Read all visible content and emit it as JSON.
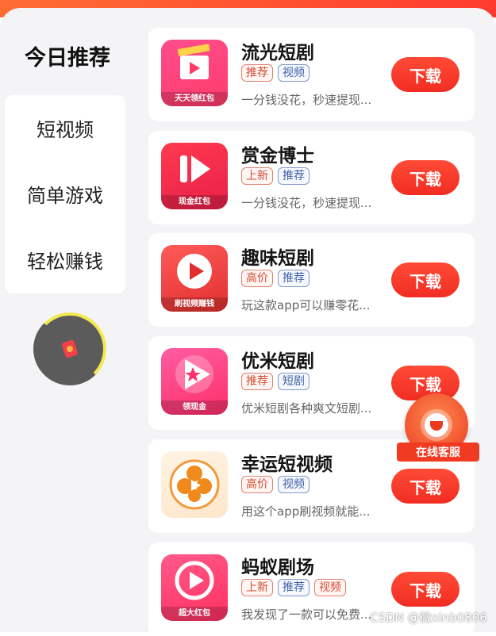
{
  "sidebar": {
    "active": "今日推荐",
    "items": [
      {
        "label": "短视频"
      },
      {
        "label": "简单游戏"
      },
      {
        "label": "轻松赚钱"
      }
    ]
  },
  "apps": [
    {
      "name": "流光短剧",
      "tags": [
        {
          "text": "推荐",
          "style": "red"
        },
        {
          "text": "视频",
          "style": "blue"
        }
      ],
      "desc": "一分钱没花，秒速提现...",
      "icon": {
        "name": "film-clapper-icon",
        "band": "天天领红包",
        "colors": [
          "#ff4d8d",
          "#ff3b6a"
        ]
      },
      "button": "下载"
    },
    {
      "name": "赏金博士",
      "tags": [
        {
          "text": "上新",
          "style": "red"
        },
        {
          "text": "推荐",
          "style": "blue"
        }
      ],
      "desc": "一分钱没花，秒速提现...",
      "icon": {
        "name": "play-bars-icon",
        "band": "现金红包",
        "colors": [
          "#ff3a4e",
          "#e8204a"
        ]
      },
      "button": "下载"
    },
    {
      "name": "趣味短剧",
      "tags": [
        {
          "text": "高价",
          "style": "red"
        },
        {
          "text": "推荐",
          "style": "blue"
        }
      ],
      "desc": "玩这款app可以赚零花...",
      "icon": {
        "name": "play-circle-icon",
        "band": "刷视频赚钱",
        "colors": [
          "#ff5a5a",
          "#e0302e"
        ]
      },
      "button": "下载"
    },
    {
      "name": "优米短剧",
      "tags": [
        {
          "text": "推荐",
          "style": "red"
        },
        {
          "text": "短剧",
          "style": "blue"
        }
      ],
      "desc": "优米短剧各种爽文短剧...",
      "icon": {
        "name": "star-play-icon",
        "band": "领现金",
        "colors": [
          "#ff5ca0",
          "#ff2f6a"
        ]
      },
      "button": "下载"
    },
    {
      "name": "幸运短视频",
      "tags": [
        {
          "text": "高价",
          "style": "red"
        },
        {
          "text": "视频",
          "style": "blue"
        }
      ],
      "desc": "用这个app刷视频就能...",
      "icon": {
        "name": "clover-play-icon",
        "band": "",
        "colors": [
          "#fff3e3",
          "#fde7cc"
        ]
      },
      "button": "下载"
    },
    {
      "name": "蚂蚁剧场",
      "tags": [
        {
          "text": "上新",
          "style": "red"
        },
        {
          "text": "推荐",
          "style": "blue"
        },
        {
          "text": "视频",
          "style": "red"
        }
      ],
      "desc": "我发现了一款可以免费...",
      "icon": {
        "name": "play-ring-icon",
        "band": "超大红包",
        "colors": [
          "#ff5a8a",
          "#ff3060"
        ]
      },
      "button": "下载"
    }
  ],
  "customer_service": {
    "label": "在线客服"
  },
  "watermark": "CSDN @微xinb0806"
}
